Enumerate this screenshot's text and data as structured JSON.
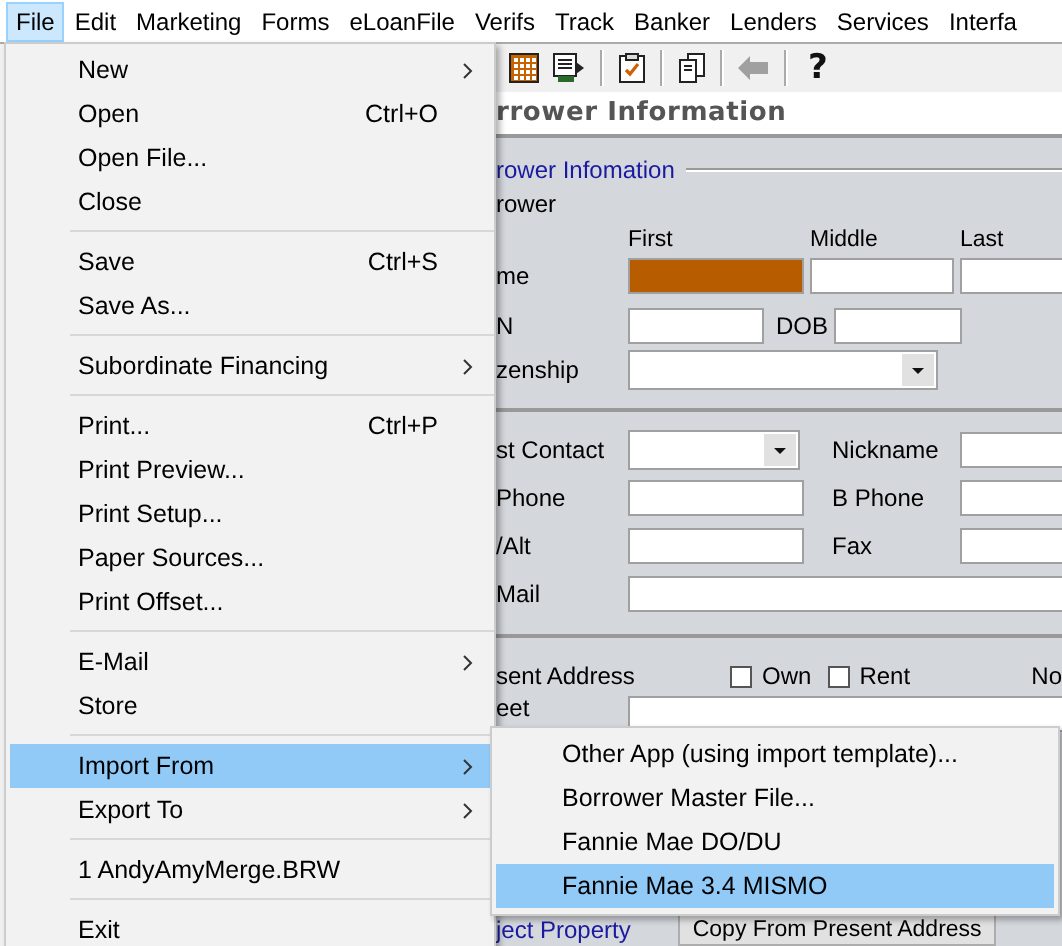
{
  "menubar": [
    {
      "label": "File",
      "selected": true
    },
    {
      "label": "Edit",
      "selected": false
    },
    {
      "label": "Marketing",
      "selected": false
    },
    {
      "label": "Forms",
      "selected": false
    },
    {
      "label": "eLoanFile",
      "selected": false
    },
    {
      "label": "Verifs",
      "selected": false
    },
    {
      "label": "Track",
      "selected": false
    },
    {
      "label": "Banker",
      "selected": false
    },
    {
      "label": "Lenders",
      "selected": false
    },
    {
      "label": "Services",
      "selected": false
    },
    {
      "label": "Interfa",
      "selected": false
    }
  ],
  "toolbar": [
    {
      "kind": "calculator",
      "disabled": false
    },
    {
      "kind": "document",
      "disabled": false
    },
    {
      "kind": "separator"
    },
    {
      "kind": "clipboard",
      "disabled": false
    },
    {
      "kind": "separator"
    },
    {
      "kind": "copy",
      "disabled": false
    },
    {
      "kind": "separator"
    },
    {
      "kind": "arrow",
      "disabled": true
    },
    {
      "kind": "separator"
    },
    {
      "kind": "help",
      "label": "?",
      "disabled": false
    }
  ],
  "form": {
    "title": "rrower Information",
    "section": "rower Infomation",
    "subsection": "rower",
    "name_label": "me",
    "name_fields": [
      {
        "header": "First",
        "highlighted": true
      },
      {
        "header": "Middle",
        "highlighted": false
      },
      {
        "header": "Last",
        "highlighted": false
      }
    ],
    "ssn_label": "N",
    "dob_label": "DOB",
    "citizenship_label": "zenship",
    "contact_label": "st Contact",
    "nickname_label": "Nickname",
    "phone_label": "Phone",
    "b_phone_label": "B Phone",
    "alt_label": "/Alt",
    "fax_label": "Fax",
    "email_label": "Mail",
    "present_address_label": "sent Address",
    "checkboxes": [
      {
        "label": "Own",
        "checked": false
      },
      {
        "label": "Rent",
        "checked": false
      }
    ],
    "cut_label": "No",
    "street_label": "eet",
    "subject_section": "ject Property",
    "copy_button": "Copy From Present Address"
  },
  "file_menu": {
    "items": [
      {
        "kind": "item",
        "label": "New",
        "submenu": true,
        "selected": false
      },
      {
        "kind": "item",
        "label": "Open",
        "shortcut": "Ctrl+O",
        "submenu": false,
        "selected": false
      },
      {
        "kind": "item",
        "label": "Open File...",
        "submenu": false,
        "selected": false
      },
      {
        "kind": "item",
        "label": "Close",
        "submenu": false,
        "selected": false
      },
      {
        "kind": "separator"
      },
      {
        "kind": "item",
        "label": "Save",
        "shortcut": "Ctrl+S",
        "submenu": false,
        "selected": false
      },
      {
        "kind": "item",
        "label": "Save As...",
        "submenu": false,
        "selected": false
      },
      {
        "kind": "separator"
      },
      {
        "kind": "item",
        "label": "Subordinate Financing",
        "submenu": true,
        "selected": false
      },
      {
        "kind": "separator"
      },
      {
        "kind": "item",
        "label": "Print...",
        "shortcut": "Ctrl+P",
        "submenu": false,
        "selected": false
      },
      {
        "kind": "item",
        "label": "Print Preview...",
        "submenu": false,
        "selected": false
      },
      {
        "kind": "item",
        "label": "Print Setup...",
        "submenu": false,
        "selected": false
      },
      {
        "kind": "item",
        "label": "Paper Sources...",
        "submenu": false,
        "selected": false
      },
      {
        "kind": "item",
        "label": "Print Offset...",
        "submenu": false,
        "selected": false
      },
      {
        "kind": "separator"
      },
      {
        "kind": "item",
        "label": "E-Mail",
        "submenu": true,
        "selected": false
      },
      {
        "kind": "item",
        "label": "Store",
        "submenu": false,
        "selected": false
      },
      {
        "kind": "separator"
      },
      {
        "kind": "item",
        "label": "Import From",
        "submenu": true,
        "selected": true
      },
      {
        "kind": "item",
        "label": "Export To",
        "submenu": true,
        "selected": false
      },
      {
        "kind": "separator"
      },
      {
        "kind": "item",
        "label": "1 AndyAmyMerge.BRW",
        "submenu": false,
        "selected": false
      },
      {
        "kind": "separator"
      },
      {
        "kind": "item",
        "label": "Exit",
        "submenu": false,
        "selected": false
      }
    ]
  },
  "import_submenu": {
    "items": [
      {
        "label": "Other App (using import template)...",
        "selected": false
      },
      {
        "label": "Borrower Master File...",
        "selected": false
      },
      {
        "label": "Fannie Mae DO/DU",
        "selected": false
      },
      {
        "label": "Fannie Mae 3.4 MISMO",
        "selected": true
      }
    ]
  }
}
